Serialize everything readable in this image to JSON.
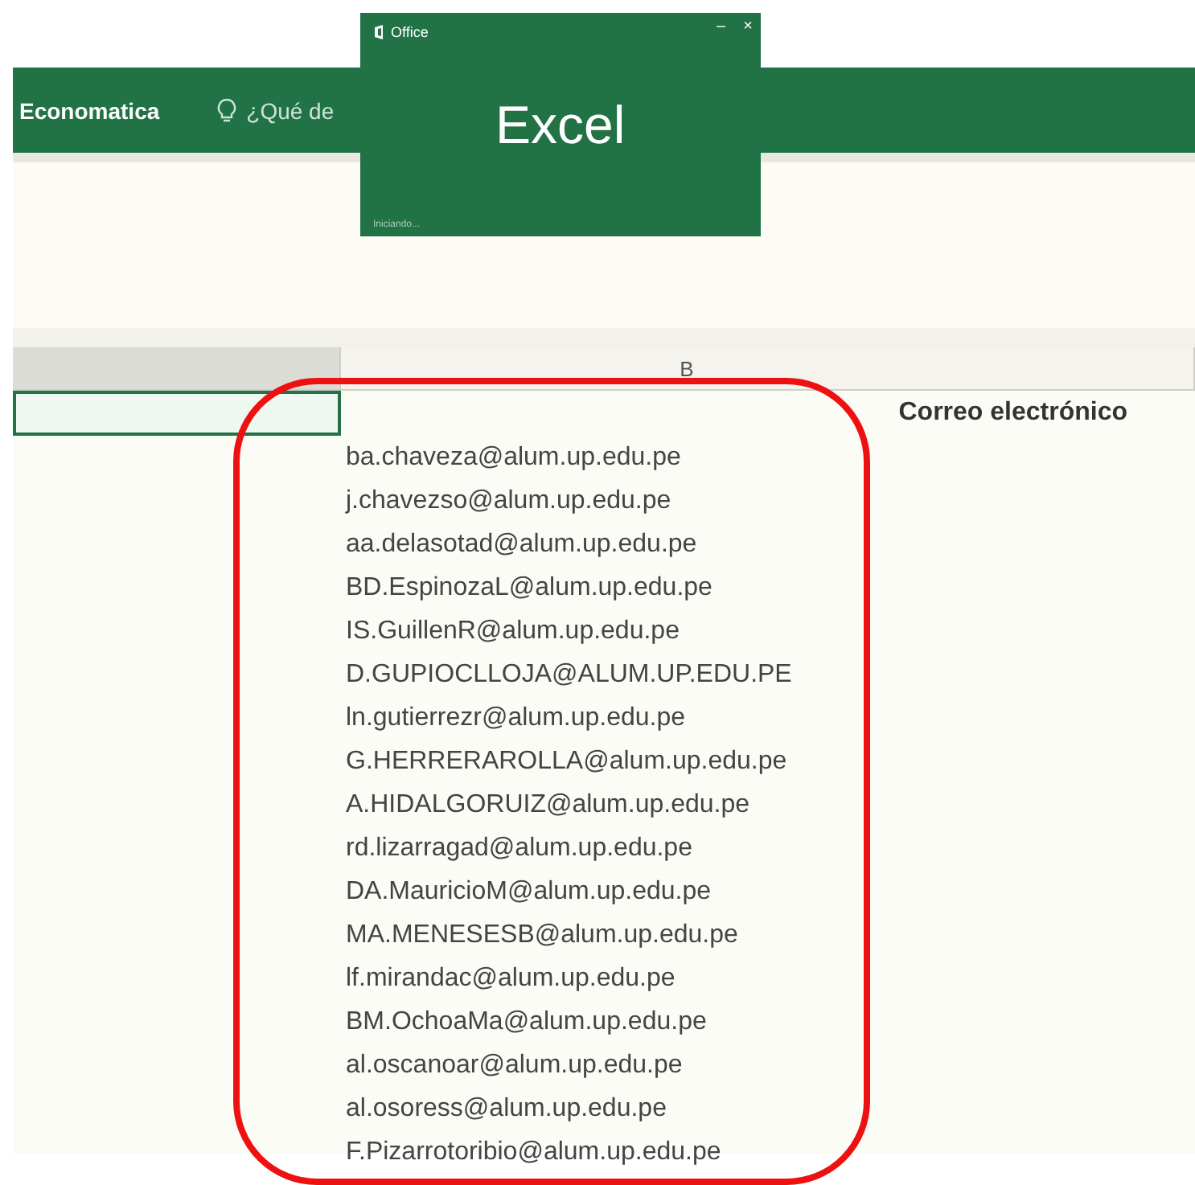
{
  "ribbon": {
    "items": [
      {
        "kind": "tab",
        "label": "Economatica"
      },
      {
        "kind": "search",
        "label": "¿Qué de"
      }
    ]
  },
  "splash": {
    "brand": "Office",
    "minimize": "–",
    "close": "×",
    "product": "Excel",
    "status": "Iniciando..."
  },
  "sheet": {
    "columns": [
      {
        "selected": true
      },
      {
        "label": "B",
        "selected": false
      }
    ],
    "header": "Correo electrónico",
    "emails": [
      "ba.chaveza@alum.up.edu.pe",
      "j.chavezso@alum.up.edu.pe",
      "aa.delasotad@alum.up.edu.pe",
      "BD.EspinozaL@alum.up.edu.pe",
      "IS.GuillenR@alum.up.edu.pe",
      "D.GUPIOCLLOJA@ALUM.UP.EDU.PE",
      "ln.gutierrezr@alum.up.edu.pe",
      "G.HERRERAROLLA@alum.up.edu.pe",
      "A.HIDALGORUIZ@alum.up.edu.pe",
      "rd.lizarragad@alum.up.edu.pe",
      "DA.MauricioM@alum.up.edu.pe",
      "MA.MENESESB@alum.up.edu.pe",
      "lf.mirandac@alum.up.edu.pe",
      "BM.OchoaMa@alum.up.edu.pe",
      "al.oscanoar@alum.up.edu.pe",
      "al.osoress@alum.up.edu.pe",
      "F.Pizarrotoribio@alum.up.edu.pe"
    ]
  }
}
